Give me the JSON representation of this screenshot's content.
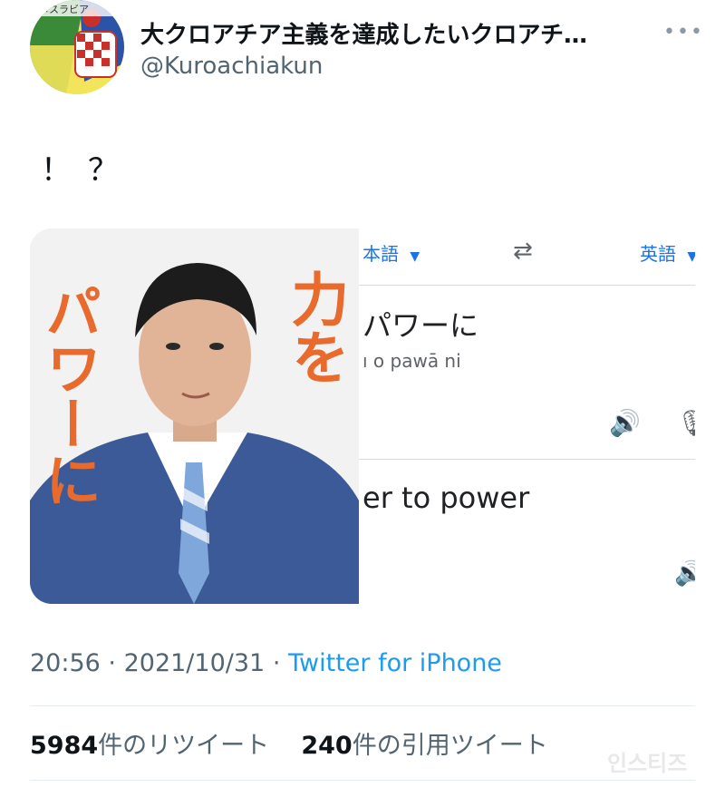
{
  "tweet": {
    "display_name": "大クロアチア主義を達成したいクロアチ…",
    "handle": "@Kuroachiakun",
    "text": "！？",
    "more_icon": "more-horizontal-icon",
    "avatar_badge_text": "メスラビア"
  },
  "media": {
    "poster_text_left": "パワーに",
    "poster_text_right": "力を",
    "translate": {
      "source_lang": "本語",
      "target_lang": "英語",
      "swap_icon": "swap-arrows-icon",
      "source_text": "パワーに",
      "romanization": "ı o pawā ni",
      "speaker_icon": "speaker-icon",
      "mic_icon": "mic-icon",
      "translated_text": "er to power"
    }
  },
  "meta": {
    "time": "20:56",
    "date": "2021/10/31",
    "separator": "·",
    "source": "Twitter for iPhone"
  },
  "stats": {
    "retweets_count": "5984",
    "retweets_label": "件のリツイート",
    "quotes_count": "240",
    "quotes_label": "件の引用ツイート"
  },
  "watermark": "인스티즈"
}
